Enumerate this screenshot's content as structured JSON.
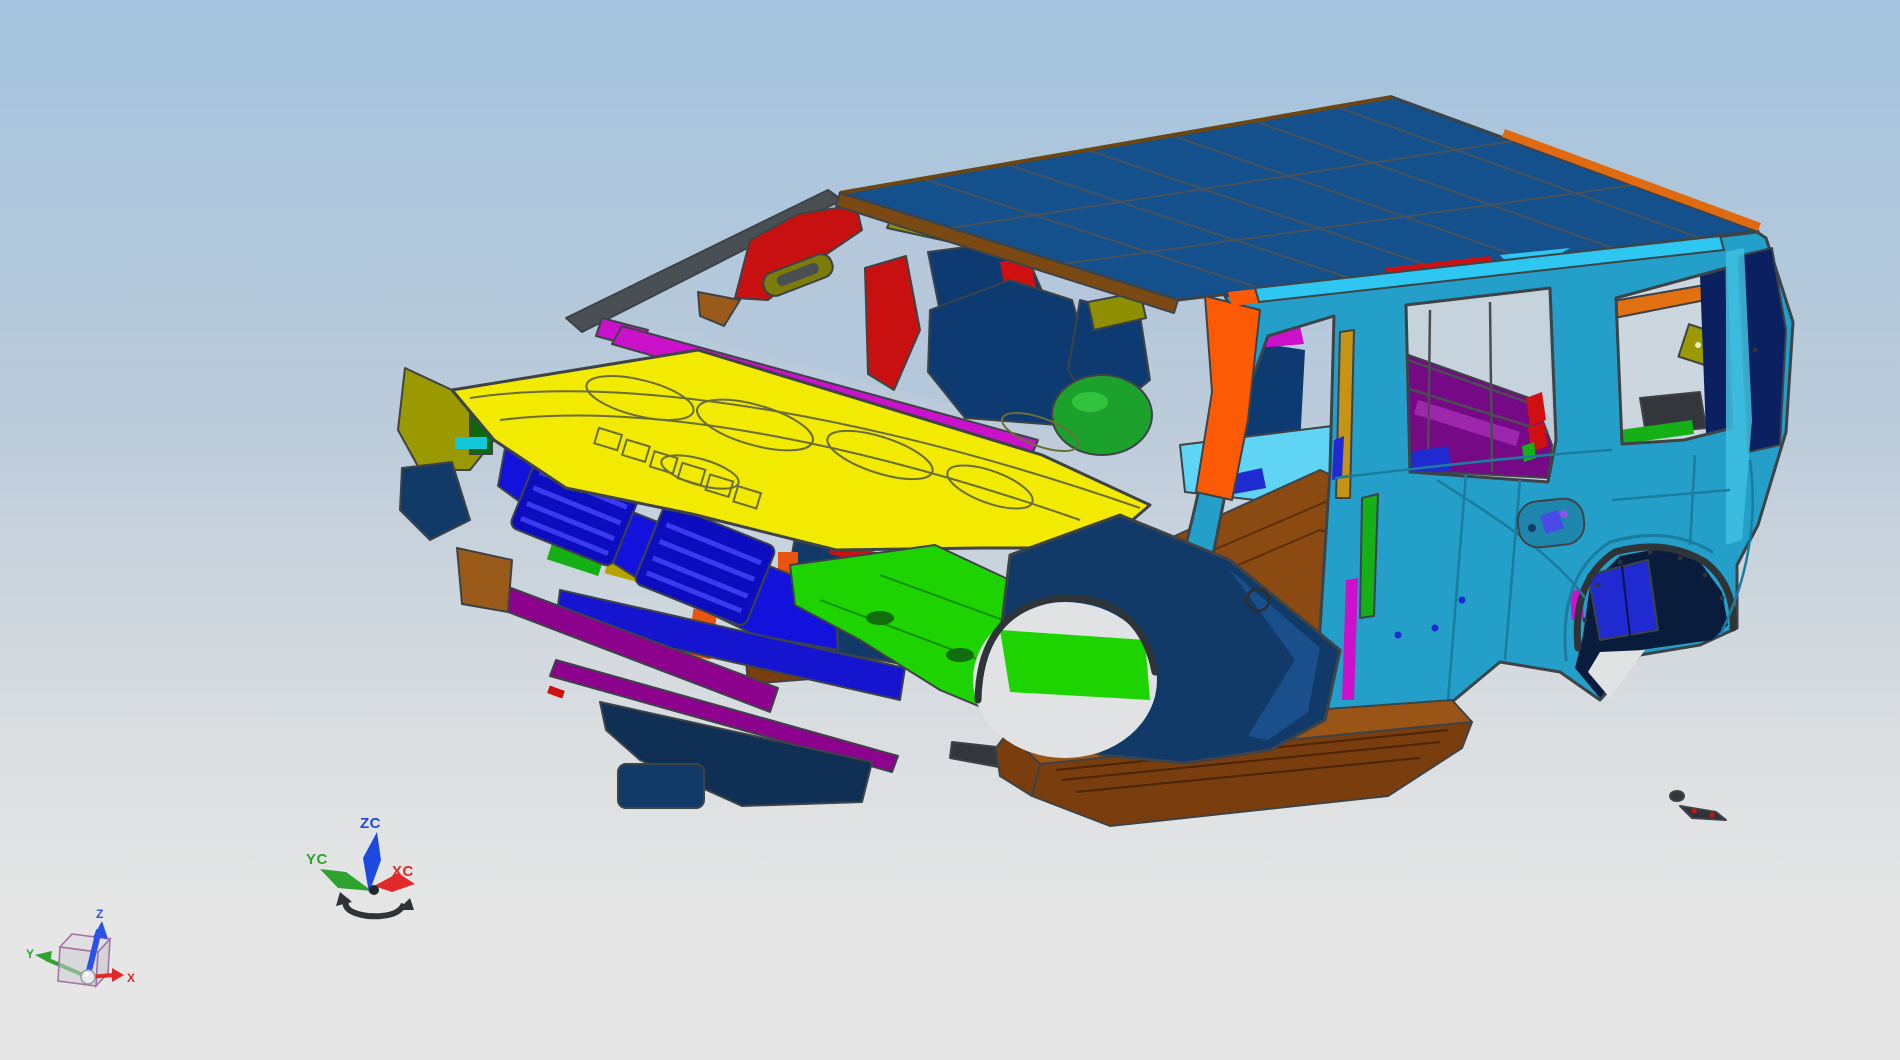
{
  "viewport": {
    "background_top": "#a3c3de",
    "background_upper_mid": "#bccbda",
    "background_lower_mid": "#d9dde0",
    "background_bottom": "#e6e6e6",
    "edge_color": "#3e4347"
  },
  "model": {
    "parts": {
      "hood": "#f2ea00",
      "hood_line": "#6a6d3a",
      "roof": "#13508c",
      "roof_grid": "#47525c",
      "roof_trim_front": "#7b4a12",
      "roof_trim_rear": "#e06a10",
      "body": "#239fc9",
      "body_light": "#3fc0e2",
      "body_shadow": "#1b7c9e",
      "roof_rail": "#2ec7f2",
      "rail_red": "#d01010",
      "a_pillar_orange": "#fd5a05",
      "pillar_gold": "#c59316",
      "pillar_green": "#15b015",
      "pillar_magenta": "#cc10cc",
      "cowl_magenta": "#ca12ca",
      "inner_red": "#c81010",
      "olive": "#8f8f04",
      "fender_olive": "#9a9a00",
      "navy": "#123a68",
      "frame_navy": "#0a2060",
      "interior_navy": "#0e3a72",
      "arch_navy": "#0a1c3c",
      "radiator_blue": "#1212dc",
      "radiator_dark": "#0d0dc0",
      "royal_blue": "#1f2ad0",
      "bumper_purple": "#8d028d",
      "quarter_purple": "#760a86",
      "floor_green": "#1ed400",
      "dome_green": "#1da12d",
      "floor_cyan": "#5fd4f4",
      "sill_cyan": "#3ed2ea",
      "accent_cyan": "#10c8d8",
      "floor_brown": "#8a4a12",
      "board_brown": "#7a3d0e",
      "board_top": "#9a5516",
      "bracket_brown": "#9a5a1a",
      "shelf_orange": "#e07010",
      "accent_orange": "#e85510",
      "accent_pink": "#e23cc8",
      "accent_red": "#d01010",
      "accent_gold": "#b5a400",
      "handle_blue": "#4a4ae8",
      "dark": "#33373b",
      "bg_patch": "#e0e2e3",
      "sky_ws": "#b5c8db",
      "sky_side": "#c6d2dc",
      "sky_qtr": "#ccd6de"
    }
  },
  "wcs_triad": {
    "axes": [
      {
        "id": "zc",
        "label": "ZC",
        "color": "#1d49e0"
      },
      {
        "id": "yc",
        "label": "YC",
        "color": "#2fa32f"
      },
      {
        "id": "xc",
        "label": "XC",
        "color": "#e02a2a"
      }
    ],
    "rotation_handle_color": "#2f3236"
  },
  "view_triad": {
    "axes": [
      {
        "id": "z",
        "label": "Z",
        "color": "#2a52e8"
      },
      {
        "id": "y",
        "label": "Y",
        "color": "#2fa32f"
      },
      {
        "id": "x",
        "label": "X",
        "color": "#e02a2a"
      }
    ],
    "cube_edge_color": "#a871a8"
  }
}
